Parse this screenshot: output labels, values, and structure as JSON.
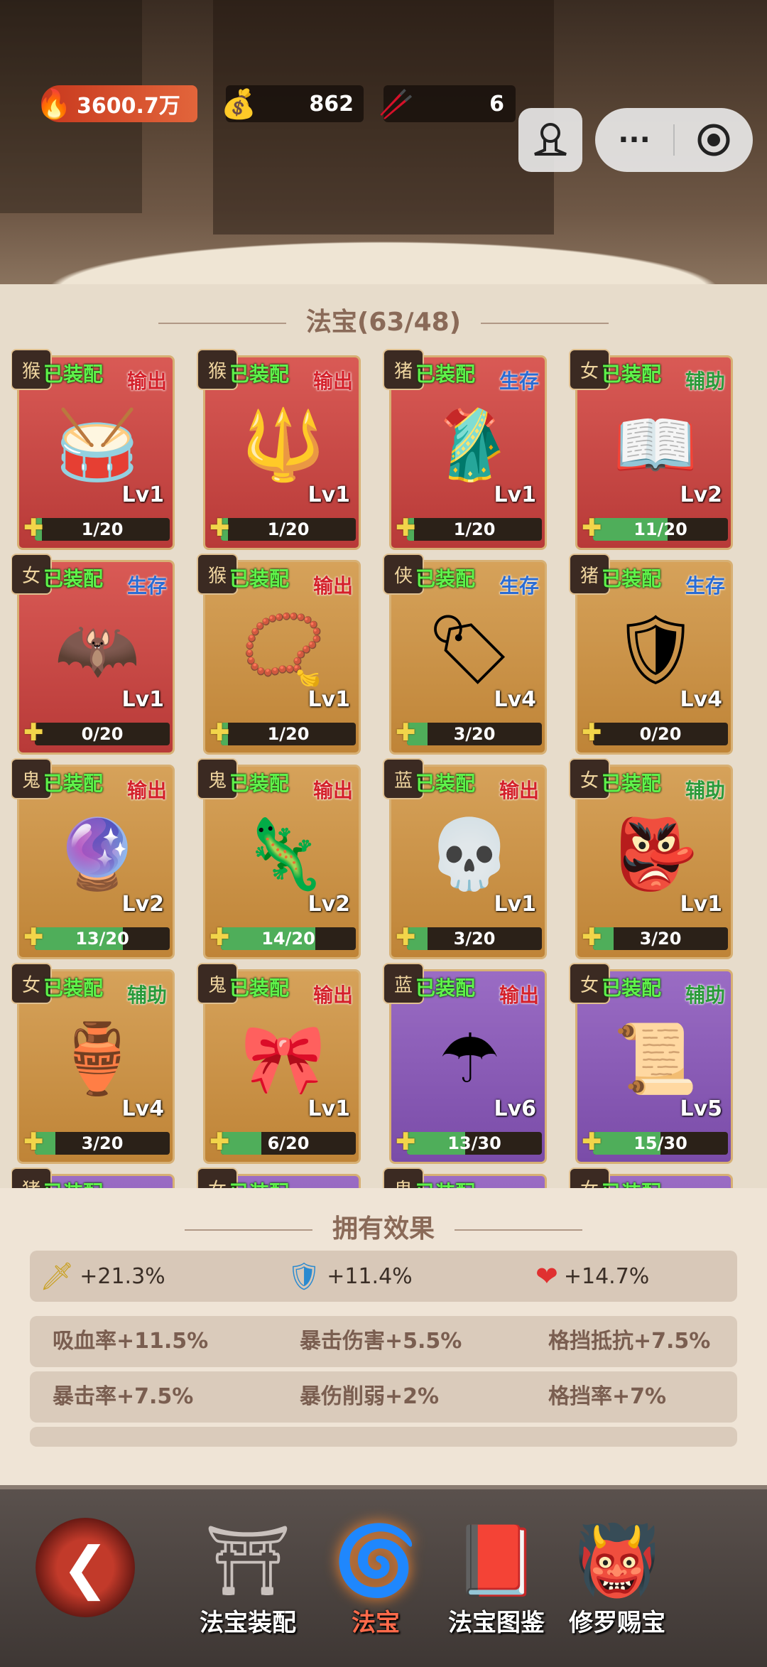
{
  "top": {
    "power": "3600.7万",
    "gold": "862",
    "sticks": "6"
  },
  "title": {
    "label": "法宝",
    "count": "(63/48)"
  },
  "cards": [
    {
      "bg": "red",
      "equipped": "已装配",
      "role": "输出",
      "role_type": "out",
      "item": "drum-icon",
      "glyph": "🥁",
      "lv": "Lv1",
      "progress": "1/20",
      "fraction": 0.05,
      "avatar": "猴"
    },
    {
      "bg": "red",
      "equipped": "已装配",
      "role": "输出",
      "role_type": "out",
      "item": "vajra-icon",
      "glyph": "🔱",
      "lv": "Lv1",
      "progress": "1/20",
      "fraction": 0.05,
      "avatar": "猴"
    },
    {
      "bg": "red",
      "equipped": "已装配",
      "role": "生存",
      "role_type": "live",
      "item": "kasaya-robe-icon",
      "glyph": "🥻",
      "lv": "Lv1",
      "progress": "1/20",
      "fraction": 0.05,
      "avatar": "猪"
    },
    {
      "bg": "red",
      "equipped": "已装配",
      "role": "辅助",
      "role_type": "aid",
      "item": "scroll-book-icon",
      "glyph": "📖",
      "lv": "Lv2",
      "progress": "11/20",
      "fraction": 0.55,
      "avatar": "女"
    },
    {
      "bg": "red",
      "equipped": "已装配",
      "role": "生存",
      "role_type": "live",
      "item": "bat-wings-icon",
      "glyph": "🦇",
      "lv": "Lv1",
      "progress": "0/20",
      "fraction": 0,
      "avatar": "女"
    },
    {
      "bg": "gold",
      "equipped": "已装配",
      "role": "输出",
      "role_type": "out",
      "item": "prayer-beads-icon",
      "glyph": "📿",
      "lv": "Lv1",
      "progress": "1/20",
      "fraction": 0.05,
      "avatar": "猴"
    },
    {
      "bg": "gold",
      "equipped": "已装配",
      "role": "生存",
      "role_type": "live",
      "item": "jade-token-icon",
      "glyph": "🏷",
      "lv": "Lv4",
      "progress": "3/20",
      "fraction": 0.15,
      "avatar": "侠"
    },
    {
      "bg": "gold",
      "equipped": "已装配",
      "role": "生存",
      "role_type": "live",
      "item": "dragon-shield-icon",
      "glyph": "🛡",
      "lv": "Lv4",
      "progress": "0/20",
      "fraction": 0,
      "avatar": "猪"
    },
    {
      "bg": "gold",
      "equipped": "已装配",
      "role": "输出",
      "role_type": "out",
      "item": "water-orb-icon",
      "glyph": "🔮",
      "lv": "Lv2",
      "progress": "13/20",
      "fraction": 0.65,
      "avatar": "鬼"
    },
    {
      "bg": "gold",
      "equipped": "已装配",
      "role": "输出",
      "role_type": "out",
      "item": "fire-lizard-icon",
      "glyph": "🦎",
      "lv": "Lv2",
      "progress": "14/20",
      "fraction": 0.7,
      "avatar": "鬼"
    },
    {
      "bg": "gold",
      "equipped": "已装配",
      "role": "输出",
      "role_type": "out",
      "item": "ox-skull-icon",
      "glyph": "💀",
      "lv": "Lv1",
      "progress": "3/20",
      "fraction": 0.15,
      "avatar": "蓝"
    },
    {
      "bg": "gold",
      "equipped": "已装配",
      "role": "辅助",
      "role_type": "aid",
      "item": "opera-mask-icon",
      "glyph": "👺",
      "lv": "Lv1",
      "progress": "3/20",
      "fraction": 0.15,
      "avatar": "女"
    },
    {
      "bg": "gold",
      "equipped": "已装配",
      "role": "辅助",
      "role_type": "aid",
      "item": "gourd-bottle-icon",
      "glyph": "🏺",
      "lv": "Lv4",
      "progress": "3/20",
      "fraction": 0.15,
      "avatar": "女"
    },
    {
      "bg": "gold",
      "equipped": "已装配",
      "role": "输出",
      "role_type": "out",
      "item": "knot-charm-icon",
      "glyph": "🎀",
      "lv": "Lv1",
      "progress": "6/20",
      "fraction": 0.3,
      "avatar": "鬼"
    },
    {
      "bg": "purple",
      "equipped": "已装配",
      "role": "输出",
      "role_type": "out",
      "item": "umbrella-icon",
      "glyph": "☂",
      "lv": "Lv6",
      "progress": "13/30",
      "fraction": 0.433,
      "avatar": "蓝"
    },
    {
      "bg": "purple",
      "equipped": "已装配",
      "role": "辅助",
      "role_type": "aid",
      "item": "talisman-scroll-icon",
      "glyph": "📜",
      "lv": "Lv5",
      "progress": "15/30",
      "fraction": 0.5,
      "avatar": "女"
    },
    {
      "bg": "purple",
      "equipped": "已装配",
      "role": "",
      "role_type": "out",
      "item": "partial-card",
      "glyph": "",
      "lv": "",
      "progress": "",
      "fraction": 0,
      "avatar": "猪"
    },
    {
      "bg": "purple",
      "equipped": "已装配",
      "role": "",
      "role_type": "out",
      "item": "partial-card",
      "glyph": "",
      "lv": "",
      "progress": "",
      "fraction": 0,
      "avatar": "女"
    },
    {
      "bg": "purple",
      "equipped": "已装配",
      "role": "",
      "role_type": "out",
      "item": "partial-card",
      "glyph": "",
      "lv": "",
      "progress": "",
      "fraction": 0,
      "avatar": "鬼"
    },
    {
      "bg": "purple",
      "equipped": "已装配",
      "role": "",
      "role_type": "out",
      "item": "partial-card",
      "glyph": "",
      "lv": "",
      "progress": "",
      "fraction": 0,
      "avatar": "女"
    }
  ],
  "effects": {
    "title": "拥有效果",
    "attack": "+21.3%",
    "defense": "+11.4%",
    "hp": "+14.7%",
    "rows": [
      [
        "吸血率+11.5%",
        "暴击伤害+5.5%",
        "格挡抵抗+7.5%"
      ],
      [
        "暴击率+7.5%",
        "暴伤削弱+2%",
        "格挡率+7%"
      ]
    ]
  },
  "nav": {
    "tabs": [
      {
        "label": "法宝装配",
        "icon": "pavilion-icon",
        "glyph": "⛩",
        "active": false
      },
      {
        "label": "法宝",
        "icon": "cloud-swirl-icon",
        "glyph": "🌀",
        "active": true
      },
      {
        "label": "法宝图鉴",
        "icon": "book-icon",
        "glyph": "📕",
        "active": false
      },
      {
        "label": "修罗赐宝",
        "icon": "asura-statue-icon",
        "glyph": "👹",
        "active": false
      }
    ]
  }
}
